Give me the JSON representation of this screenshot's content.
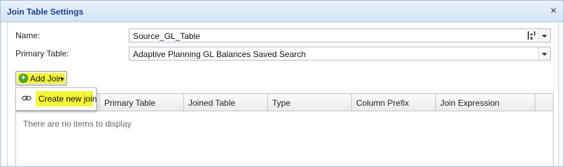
{
  "window": {
    "title": "Join Table Settings",
    "close_symbol": "×"
  },
  "form": {
    "name_label": "Name:",
    "name_value": "Source_GL_Table",
    "primary_table_label": "Primary Table:",
    "primary_table_value": "Adaptive Planning GL Balances Saved Search"
  },
  "toolbar": {
    "add_join_label": "Add Join",
    "add_join_icon": "plus-circle-icon"
  },
  "menu": {
    "items": [
      {
        "label": "Create new join",
        "icon": "link-icon"
      }
    ]
  },
  "grid": {
    "columns": [
      "Primary Table",
      "Joined Table",
      "Type",
      "Column Prefix",
      "Join Expression"
    ],
    "empty_text": "There are no items to display"
  },
  "colors": {
    "title_text": "#15428b",
    "highlight": "#f5f53a",
    "add_icon": "#4cae32"
  }
}
